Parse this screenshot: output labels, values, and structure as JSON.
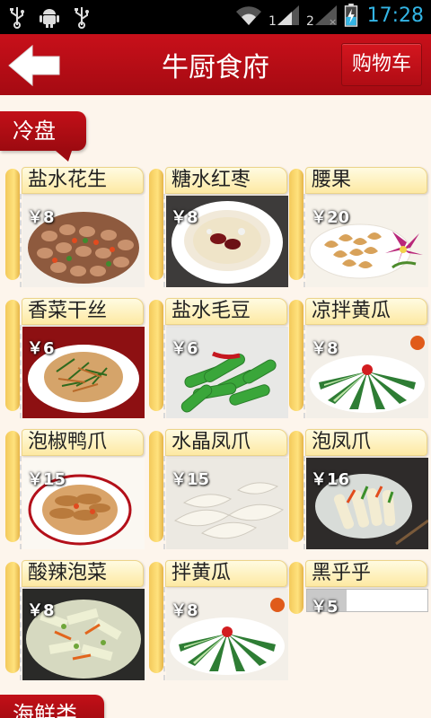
{
  "status_bar": {
    "time": "17:28"
  },
  "header": {
    "title": "牛厨食府",
    "back_label": "",
    "cart_label": "购物车"
  },
  "sections": [
    {
      "title": "冷盘",
      "items": [
        {
          "name": "盐水花生",
          "price": "￥8",
          "icon": "peanuts-photo"
        },
        {
          "name": "糖水红枣",
          "price": "￥8",
          "icon": "dates-soup-photo"
        },
        {
          "name": "腰果",
          "price": "￥20",
          "icon": "cashew-photo"
        },
        {
          "name": "香菜干丝",
          "price": "￥6",
          "icon": "tofu-shreds-photo"
        },
        {
          "name": "盐水毛豆",
          "price": "￥6",
          "icon": "edamame-photo"
        },
        {
          "name": "凉拌黄瓜",
          "price": "￥8",
          "icon": "cucumber-photo"
        },
        {
          "name": "泡椒鸭爪",
          "price": "￥15",
          "icon": "duck-feet-photo"
        },
        {
          "name": "水晶凤爪",
          "price": "￥15",
          "icon": "chicken-feet-photo"
        },
        {
          "name": "泡凤爪",
          "price": "￥16",
          "icon": "pickled-feet-photo"
        },
        {
          "name": "酸辣泡菜",
          "price": "￥8",
          "icon": "kimchi-photo"
        },
        {
          "name": "拌黄瓜",
          "price": "￥8",
          "icon": "cucumber-salad-photo"
        },
        {
          "name": "黑乎乎",
          "price": "￥5",
          "icon": "no-photo"
        }
      ]
    },
    {
      "title": "海鲜类"
    }
  ],
  "colors": {
    "header_red": "#b30d15",
    "tab_yellow": "#f6d56b",
    "status_time": "#33b5e5"
  }
}
